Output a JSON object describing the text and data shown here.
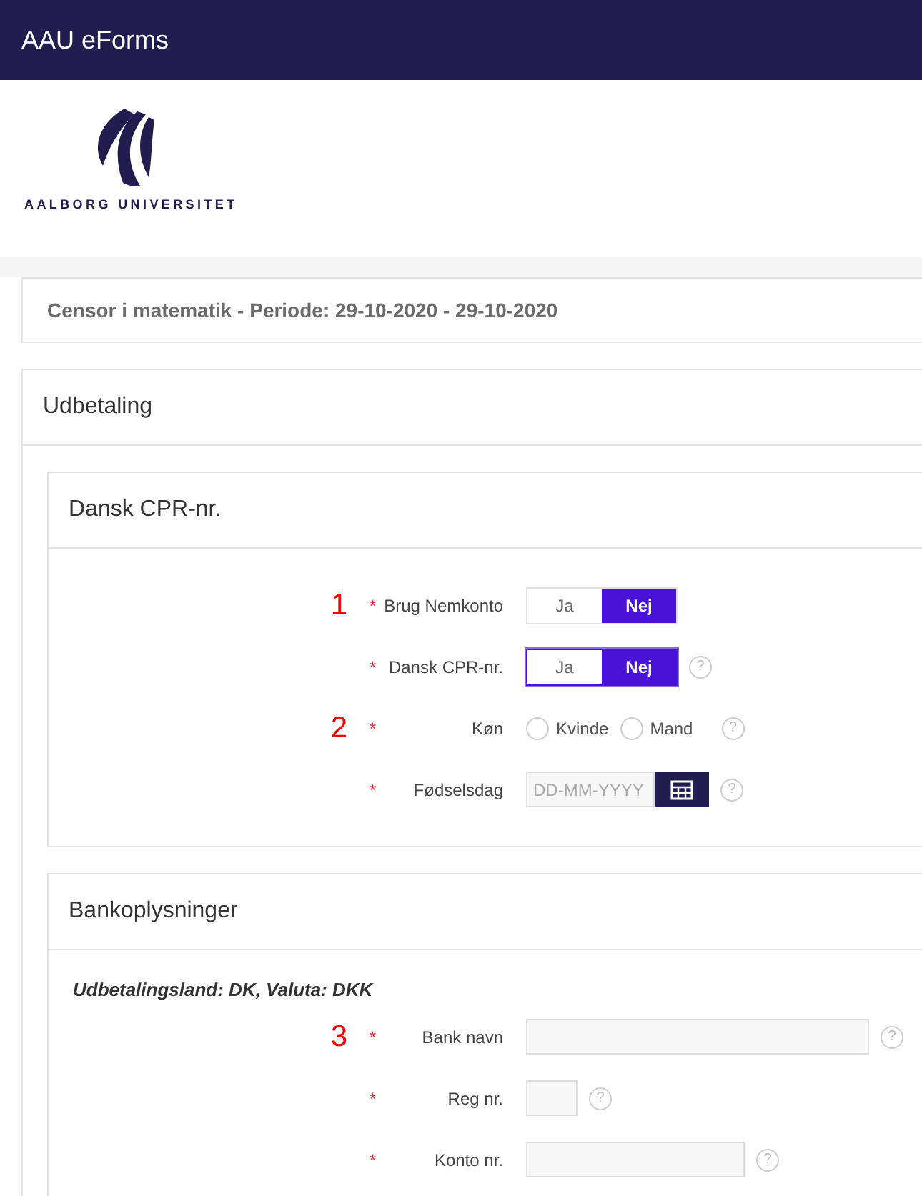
{
  "app_bar": {
    "title": "AAU eForms"
  },
  "logo": {
    "text": "AALBORG UNIVERSITET"
  },
  "summary": {
    "text": "Censor i matematik - Periode: 29-10-2020 - 29-10-2020"
  },
  "section": {
    "title": "Udbetaling",
    "cards": [
      {
        "title": "Dansk CPR-nr.",
        "rows": [
          {
            "kind": "toggle",
            "annotation": "1",
            "required": "*",
            "label": "Brug Nemkonto",
            "focused": false,
            "options": [
              {
                "label": "Ja",
                "selected": false
              },
              {
                "label": "Nej",
                "selected": true
              }
            ]
          },
          {
            "kind": "toggle",
            "required": "*",
            "label": "Dansk CPR-nr.",
            "help": "?",
            "focused": true,
            "options": [
              {
                "label": "Ja",
                "selected": false
              },
              {
                "label": "Nej",
                "selected": true
              }
            ]
          },
          {
            "kind": "radio",
            "annotation": "2",
            "required": "*",
            "label": "Køn",
            "help": "?",
            "options": [
              {
                "label": "Kvinde",
                "selected": false
              },
              {
                "label": "Mand",
                "selected": false
              }
            ]
          },
          {
            "kind": "date",
            "required": "*",
            "label": "Fødselsdag",
            "help": "?",
            "placeholder": "DD-MM-YYYY"
          }
        ]
      },
      {
        "title": "Bankoplysninger",
        "subtitle": "Udbetalingsland: DK, Valuta: DKK",
        "rows": [
          {
            "kind": "text",
            "annotation": "3",
            "required": "*",
            "label": "Bank navn",
            "help": "?"
          },
          {
            "kind": "text",
            "required": "*",
            "label": "Reg nr.",
            "help": "?"
          },
          {
            "kind": "text",
            "required": "*",
            "label": "Konto nr.",
            "help": "?"
          }
        ]
      }
    ]
  }
}
